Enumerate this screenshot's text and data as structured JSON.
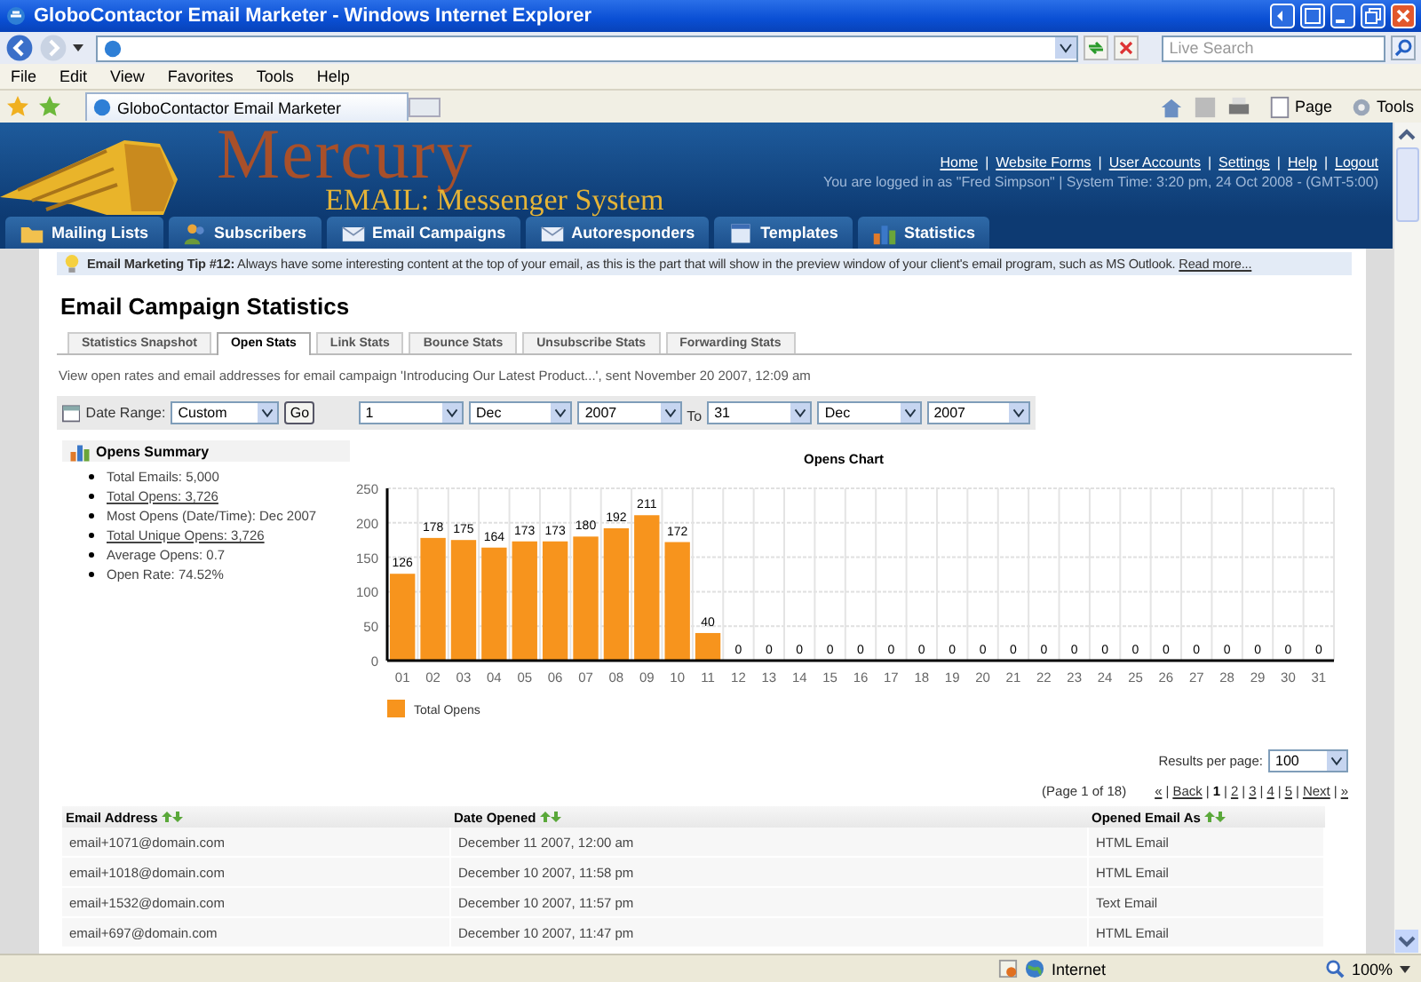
{
  "window": {
    "title": "GloboContactor Email Marketer - Windows Internet Explorer"
  },
  "browser": {
    "search_placeholder": "Live Search",
    "menu": [
      "File",
      "Edit",
      "View",
      "Favorites",
      "Tools",
      "Help"
    ],
    "tab_title": "GloboContactor Email Marketer",
    "tools": [
      "Page",
      "Tools"
    ]
  },
  "header": {
    "logo_title": "Mercury",
    "logo_subtitle": "EMAIL: Messenger System",
    "separator": "|",
    "links": [
      "Home",
      "Website Forms",
      "User Accounts",
      "Settings",
      "Help",
      "Logout"
    ],
    "login_info": "You are logged in as \"Fred Simpson\" | System Time: 3:20 pm, 24 Oct 2008 - (GMT-5:00)"
  },
  "nav": [
    "Mailing Lists",
    "Subscribers",
    "Email Campaigns",
    "Autoresponders",
    "Templates",
    "Statistics"
  ],
  "tip": {
    "label": "Email Marketing Tip #12:",
    "text": "Always have some interesting content at the top of your email, as this is the part that will show in the preview window of your client's email program, such as MS Outlook.",
    "link": "Read more..."
  },
  "page_title": "Email Campaign Statistics",
  "stat_tabs": [
    {
      "label": "Statistics Snapshot",
      "selected": false
    },
    {
      "label": "Open Stats",
      "selected": true
    },
    {
      "label": "Link Stats",
      "selected": false
    },
    {
      "label": "Bounce Stats",
      "selected": false
    },
    {
      "label": "Unsubscribe Stats",
      "selected": false
    },
    {
      "label": "Forwarding Stats",
      "selected": false
    }
  ],
  "description": "View open rates and email addresses for email campaign 'Introducing Our Latest Product...', sent November 20 2007, 12:09 am",
  "date_range": {
    "label": "Date Range:",
    "preset": "Custom",
    "go": "Go",
    "from": [
      "1",
      "Dec",
      "2007"
    ],
    "to_label": "To",
    "to": [
      "31",
      "Dec",
      "2007"
    ]
  },
  "summary": {
    "title": "Opens Summary",
    "items": [
      {
        "text": "Total Emails: 5,000",
        "kind": "text"
      },
      {
        "text": "Total Opens: 3,726",
        "kind": "link"
      },
      {
        "text": "Most Opens (Date/Time): Dec 2007",
        "kind": "text"
      },
      {
        "text": "Total Unique Opens: 3,726",
        "kind": "link"
      },
      {
        "text": "Average Opens: 0.7",
        "kind": "text"
      },
      {
        "text": "Open Rate: 74.52%",
        "kind": "text"
      }
    ]
  },
  "chart": {
    "chart_data": {
      "type": "bar",
      "title": "Opens Chart",
      "categories": [
        "01",
        "02",
        "03",
        "04",
        "05",
        "06",
        "07",
        "08",
        "09",
        "10",
        "11",
        "12",
        "13",
        "14",
        "15",
        "16",
        "17",
        "18",
        "19",
        "20",
        "21",
        "22",
        "23",
        "24",
        "25",
        "26",
        "27",
        "28",
        "29",
        "30",
        "31"
      ],
      "series": [
        {
          "name": "Total Opens",
          "color": "#f7941d",
          "values": [
            126,
            178,
            175,
            164,
            173,
            173,
            180,
            192,
            211,
            172,
            40,
            0,
            0,
            0,
            0,
            0,
            0,
            0,
            0,
            0,
            0,
            0,
            0,
            0,
            0,
            0,
            0,
            0,
            0,
            0,
            0
          ]
        }
      ],
      "ylim": [
        0,
        250
      ],
      "yticks": [
        0,
        50,
        100,
        150,
        200,
        250
      ],
      "data_labels": true,
      "grid": true
    }
  },
  "results": {
    "label": "Results per page:",
    "value": "100"
  },
  "pager": {
    "info": "(Page 1 of 18)",
    "separator": "|",
    "links": [
      {
        "label": "«",
        "selected": false
      },
      {
        "label": "Back",
        "selected": false
      },
      {
        "label": "1",
        "selected": true
      },
      {
        "label": "2",
        "selected": false
      },
      {
        "label": "3",
        "selected": false
      },
      {
        "label": "4",
        "selected": false
      },
      {
        "label": "5",
        "selected": false
      },
      {
        "label": "Next",
        "selected": false
      },
      {
        "label": "»",
        "selected": false
      }
    ]
  },
  "table": {
    "columns": [
      "Email Address",
      "Date Opened",
      "Opened Email As"
    ],
    "rows": [
      [
        "email+1071@domain.com",
        "December 11 2007, 12:00 am",
        "HTML Email"
      ],
      [
        "email+1018@domain.com",
        "December 10 2007, 11:58 pm",
        "HTML Email"
      ],
      [
        "email+1532@domain.com",
        "December 10 2007, 11:57 pm",
        "Text Email"
      ],
      [
        "email+697@domain.com",
        "December 10 2007, 11:47 pm",
        "HTML Email"
      ]
    ]
  },
  "status_bar": {
    "zone": "Internet",
    "zoom": "100%"
  }
}
